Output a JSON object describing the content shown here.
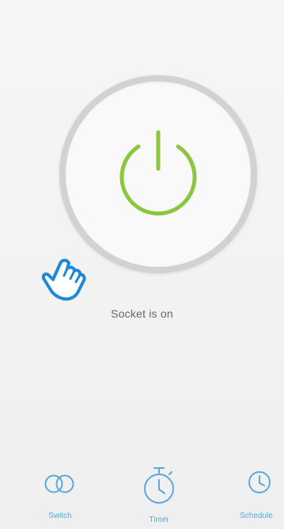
{
  "power": {
    "state": "on",
    "status_text": "Socket is on",
    "color": "#8cc63f"
  },
  "bottom_nav": {
    "tabs": [
      {
        "label": "Switch",
        "icon": "toggle-circles-icon"
      },
      {
        "label": "Timer",
        "icon": "stopwatch-icon"
      },
      {
        "label": "Schedule",
        "icon": "clock-icon"
      }
    ],
    "accent_color": "#5aa9dd"
  },
  "hint": {
    "icon": "pointing-hand-icon",
    "color": "#1e88d8"
  }
}
